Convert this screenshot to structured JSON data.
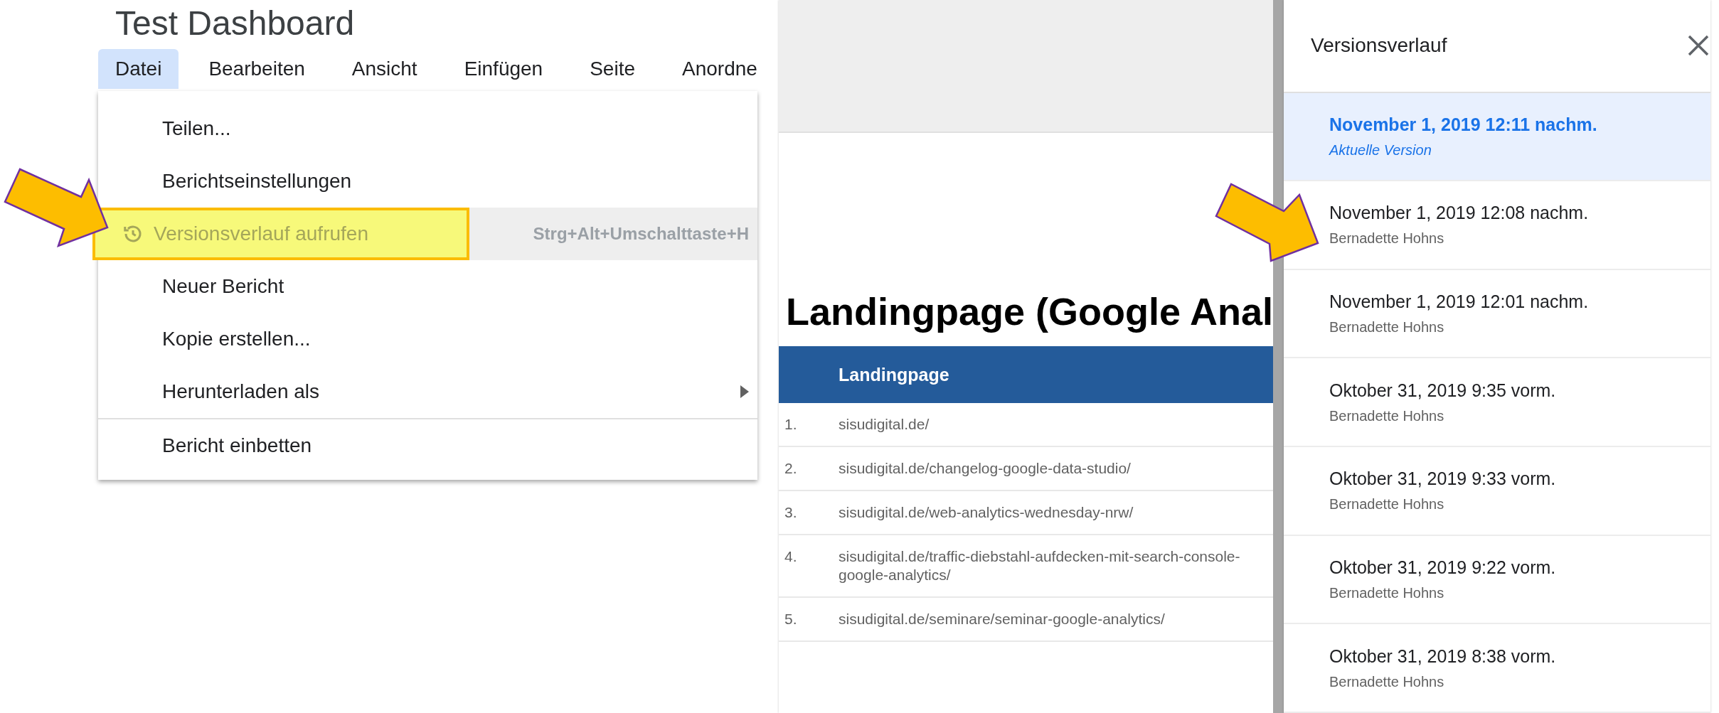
{
  "report_title": "Test Dashboard",
  "menubar": [
    {
      "label": "Datei",
      "selected": true
    },
    {
      "label": "Bearbeiten",
      "selected": false
    },
    {
      "label": "Ansicht",
      "selected": false
    },
    {
      "label": "Einfügen",
      "selected": false
    },
    {
      "label": "Seite",
      "selected": false
    },
    {
      "label": "Anordne",
      "selected": false
    }
  ],
  "file_menu": [
    {
      "label": "Teilen...",
      "highlighted": false
    },
    {
      "label": "Berichtseinstellungen",
      "highlighted": false
    },
    {
      "label": "Versionsverlauf aufrufen",
      "highlighted": true,
      "shortcut": "Strg+Alt+Umschalttaste+H"
    },
    {
      "label": "Neuer Bericht",
      "highlighted": false
    },
    {
      "label": "Kopie erstellen...",
      "highlighted": false
    },
    {
      "label": "Herunterladen als",
      "highlighted": false,
      "submenu": true
    },
    {
      "label": "Bericht einbetten",
      "highlighted": false,
      "divider_before": true
    }
  ],
  "report": {
    "title": "Landingpage (Google Anal",
    "table": {
      "columns": [
        "Landingpage"
      ],
      "rows": [
        {
          "index": "1.",
          "landingpage": "sisudigital.de/"
        },
        {
          "index": "2.",
          "landingpage": "sisudigital.de/changelog-google-data-studio/"
        },
        {
          "index": "3.",
          "landingpage": "sisudigital.de/web-analytics-wednesday-nrw/"
        },
        {
          "index": "4.",
          "landingpage": "sisudigital.de/traffic-diebstahl-aufdecken-mit-search-console-google-analytics/"
        },
        {
          "index": "5.",
          "landingpage": "sisudigital.de/seminare/seminar-google-analytics/"
        }
      ]
    }
  },
  "version_history": {
    "title": "Versionsverlauf",
    "versions": [
      {
        "date": "November 1, 2019 12:11 nachm.",
        "subtitle": "Aktuelle Version",
        "selected": true
      },
      {
        "date": "November 1, 2019 12:08 nachm.",
        "subtitle": "Bernadette Hohns",
        "selected": false
      },
      {
        "date": "November 1, 2019 12:01 nachm.",
        "subtitle": "Bernadette Hohns",
        "selected": false
      },
      {
        "date": "Oktober 31, 2019 9:35 vorm.",
        "subtitle": "Bernadette Hohns",
        "selected": false
      },
      {
        "date": "Oktober 31, 2019 9:33 vorm.",
        "subtitle": "Bernadette Hohns",
        "selected": false
      },
      {
        "date": "Oktober 31, 2019 9:22 vorm.",
        "subtitle": "Bernadette Hohns",
        "selected": false
      },
      {
        "date": "Oktober 31, 2019 8:38 vorm.",
        "subtitle": "Bernadette Hohns",
        "selected": false
      }
    ]
  }
}
